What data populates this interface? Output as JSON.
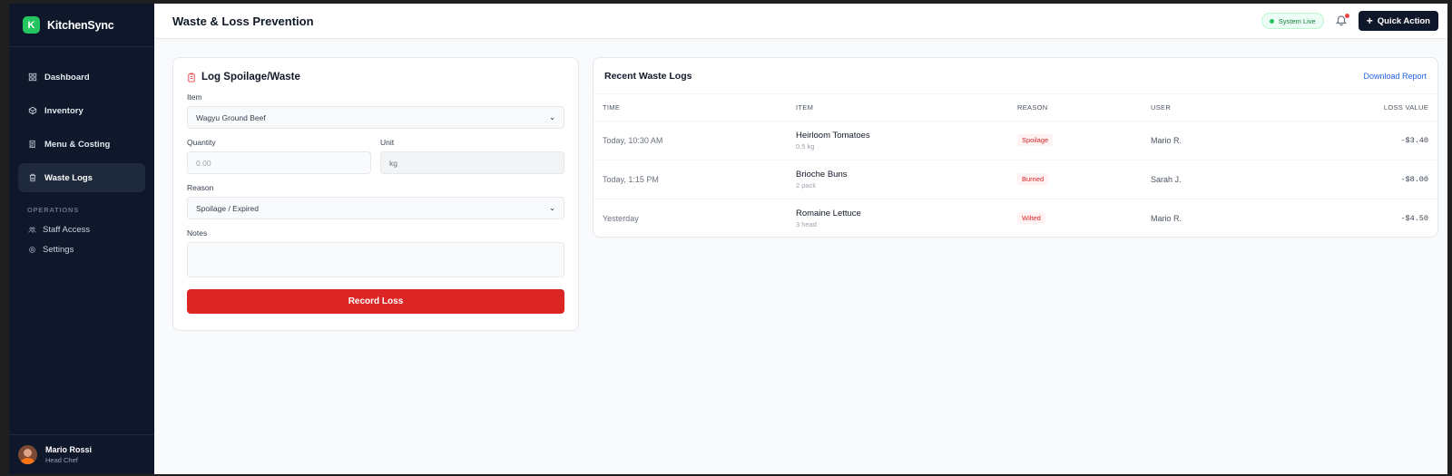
{
  "brand": {
    "logo_letter": "K",
    "name": "KitchenSync",
    "accent": "#22c55e"
  },
  "sidebar": {
    "items": [
      {
        "label": "Dashboard",
        "icon": "grid-icon"
      },
      {
        "label": "Inventory",
        "icon": "box-icon"
      },
      {
        "label": "Menu & Costing",
        "icon": "receipt-icon"
      },
      {
        "label": "Waste Logs",
        "icon": "trash-icon",
        "active": true
      }
    ],
    "section_label": "OPERATIONS",
    "sub_items": [
      {
        "label": "Staff Access",
        "icon": "users-icon"
      },
      {
        "label": "Settings",
        "icon": "gear-icon"
      }
    ],
    "user": {
      "name": "Mario Rossi",
      "role": "Head Chef"
    }
  },
  "header": {
    "title": "Waste & Loss Prevention",
    "status": "System Live",
    "quick_action": "Quick Action",
    "quick_action_icon": "+"
  },
  "form": {
    "title": "Log Spoilage/Waste",
    "item_label": "Item",
    "item_value": "Wagyu Ground Beef",
    "quantity_label": "Quantity",
    "quantity_placeholder": "0.00",
    "unit_label": "Unit",
    "unit_value": "kg",
    "reason_label": "Reason",
    "reason_value": "Spoilage / Expired",
    "notes_label": "Notes",
    "notes_value": "",
    "submit_label": "Record Loss",
    "submit_color": "#dc2626"
  },
  "logs": {
    "title": "Recent Waste Logs",
    "download_label": "Download Report",
    "columns": {
      "time": "TIME",
      "item": "ITEM",
      "reason": "REASON",
      "user": "USER",
      "loss": "LOSS VALUE"
    },
    "rows": [
      {
        "time": "Today, 10:30 AM",
        "item": "Heirloom Tomatoes",
        "qty": "0.5 kg",
        "reason": "Spoilage",
        "user": "Mario R.",
        "loss": "-$3.40"
      },
      {
        "time": "Today, 1:15 PM",
        "item": "Brioche Buns",
        "qty": "2 pack",
        "reason": "Burned",
        "user": "Sarah J.",
        "loss": "-$8.00"
      },
      {
        "time": "Yesterday",
        "item": "Romaine Lettuce",
        "qty": "3 head",
        "reason": "Wilted",
        "user": "Mario R.",
        "loss": "-$4.50"
      }
    ]
  }
}
